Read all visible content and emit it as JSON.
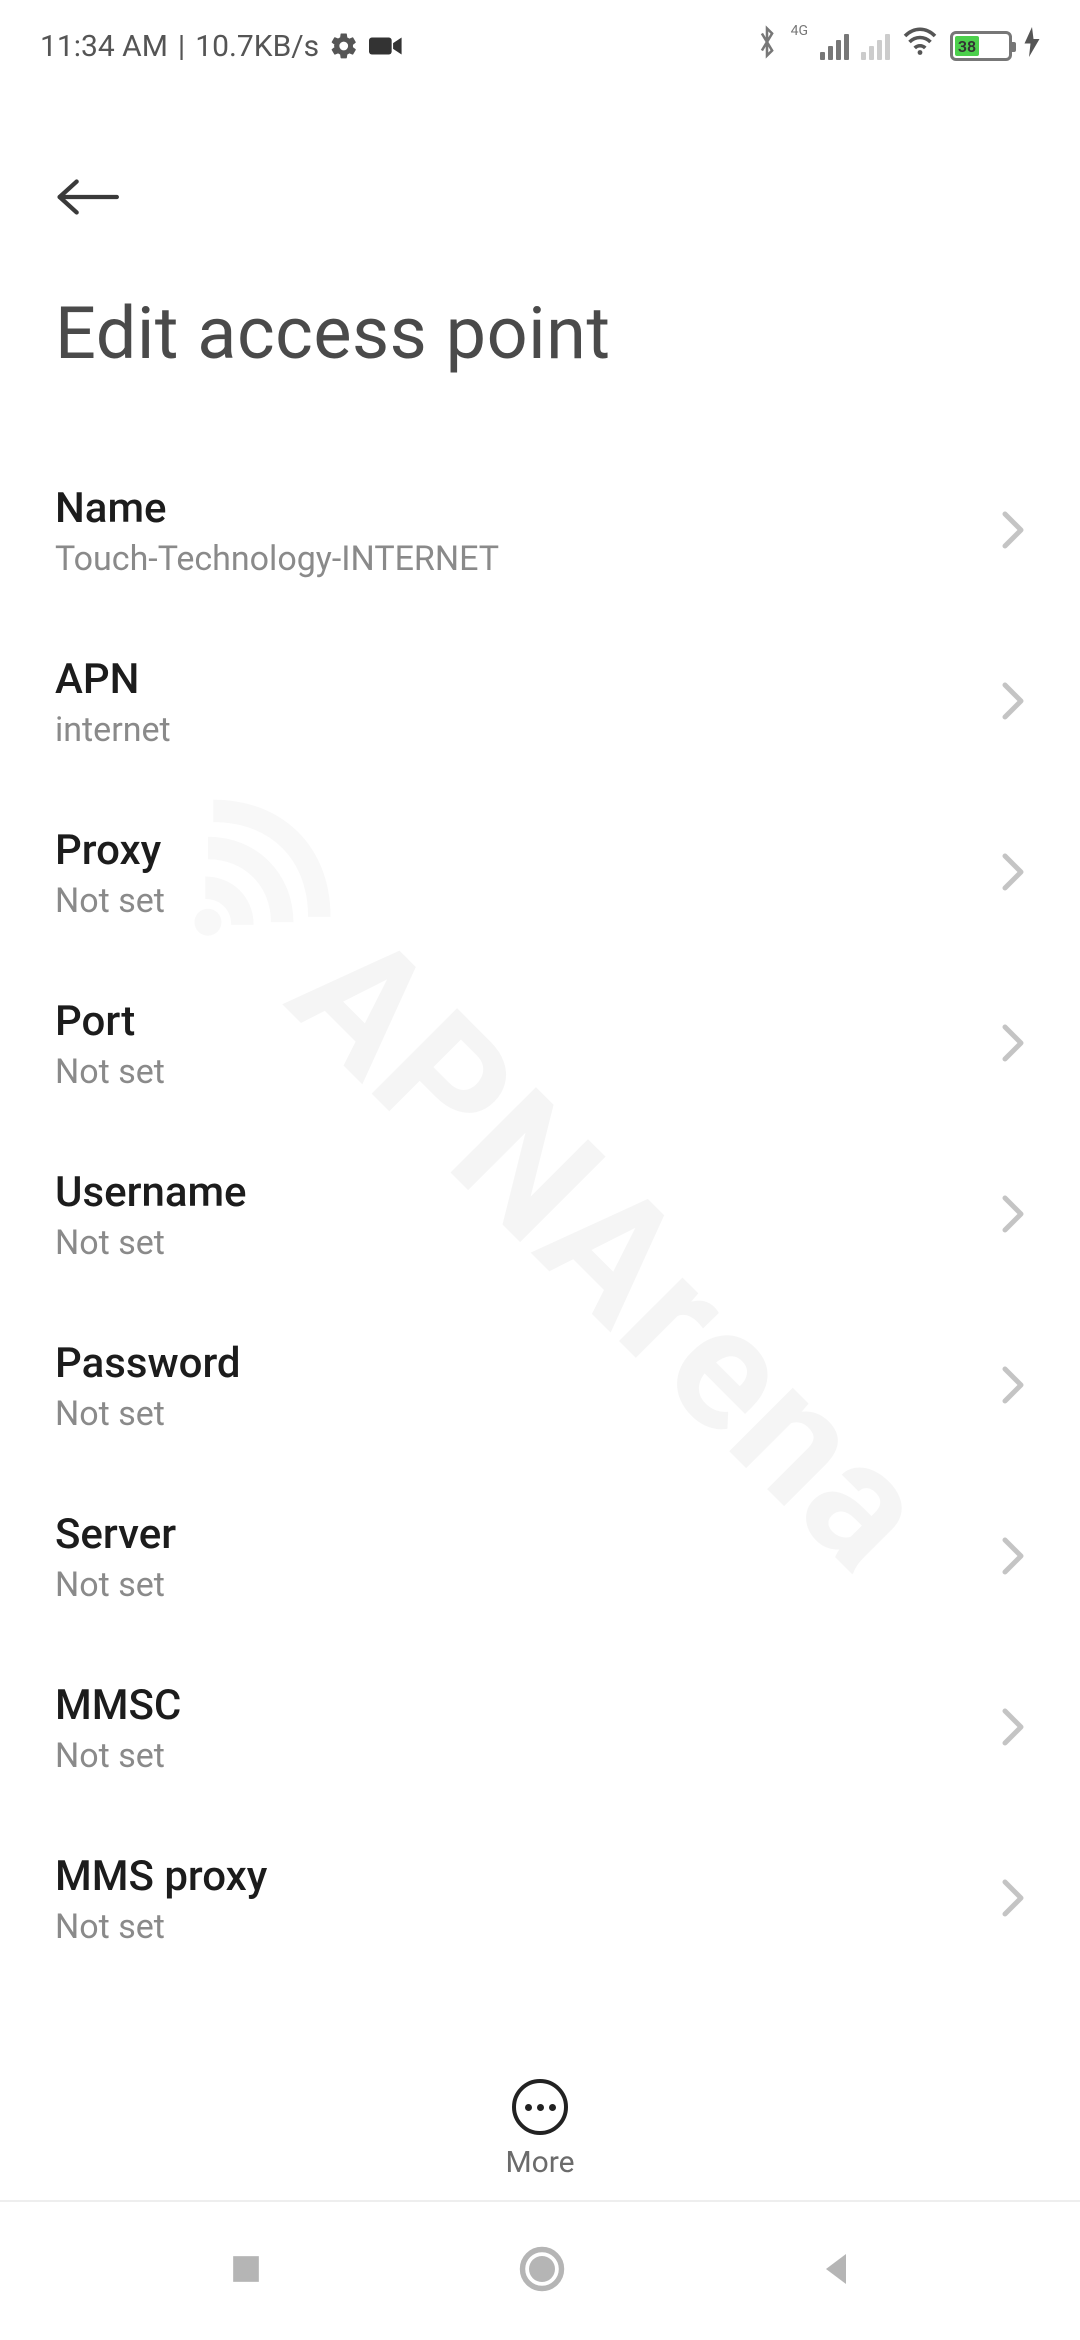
{
  "status_bar": {
    "time": "11:34 AM",
    "separator": " | ",
    "speed": "10.7KB/s",
    "network_label": "4G",
    "battery_percent": "38"
  },
  "header": {
    "title": "Edit access point"
  },
  "watermark": "APNArena",
  "settings": [
    {
      "label": "Name",
      "value": "Touch-Technology-INTERNET"
    },
    {
      "label": "APN",
      "value": "internet"
    },
    {
      "label": "Proxy",
      "value": "Not set"
    },
    {
      "label": "Port",
      "value": "Not set"
    },
    {
      "label": "Username",
      "value": "Not set"
    },
    {
      "label": "Password",
      "value": "Not set"
    },
    {
      "label": "Server",
      "value": "Not set"
    },
    {
      "label": "MMSC",
      "value": "Not set"
    },
    {
      "label": "MMS proxy",
      "value": "Not set"
    }
  ],
  "bottom_action": {
    "label": "More"
  }
}
